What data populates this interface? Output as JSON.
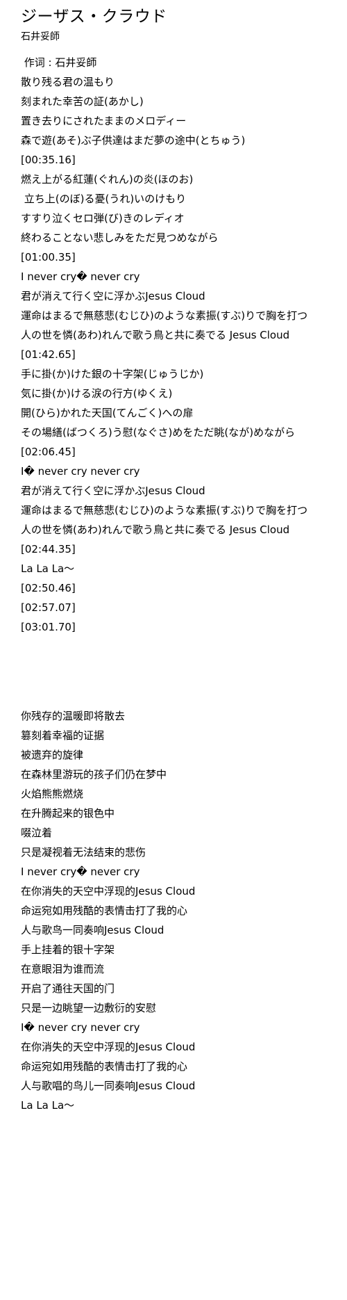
{
  "song": {
    "title": "ジーザス・クラウド",
    "artist": "石井妥師"
  },
  "primary_lyrics": {
    "lines": [
      {
        "text": " 作词 : 石井妥師",
        "type": "credit"
      },
      {
        "text": "散り残る君の温もり",
        "type": "lyric"
      },
      {
        "text": "刻まれた幸苦の証(あかし)",
        "type": "lyric"
      },
      {
        "text": "置き去りにされたままのメロディー",
        "type": "lyric"
      },
      {
        "text": "森で遊(あそ)ぶ子供達はまだ夢の途中(とちゅう)",
        "type": "lyric"
      },
      {
        "text": "[00:35.16]",
        "type": "timestamp"
      },
      {
        "text": "燃え上がる紅蓮(ぐれん)の炎(ほのお)",
        "type": "lyric"
      },
      {
        "text": " 立ち上(のぼ)る憂(うれ)いのけもり",
        "type": "lyric"
      },
      {
        "text": "すすり泣くセロ弾(び)きのレディオ",
        "type": "lyric"
      },
      {
        "text": "終わることない悲しみをただ見つめながら",
        "type": "lyric"
      },
      {
        "text": "[01:00.35]",
        "type": "timestamp"
      },
      {
        "text": "I never cry� never cry",
        "type": "latin"
      },
      {
        "text": "君が消えて行く空に浮かぶJesus Cloud",
        "type": "lyric"
      },
      {
        "text": "運命はまるで無慈悲(むじひ)のような素振(すぶ)りで胸を打つ",
        "type": "lyric"
      },
      {
        "text": "人の世を憐(あわ)れんで歌う鳥と共に奏でる Jesus Cloud",
        "type": "wrapped"
      },
      {
        "text": "[01:42.65]",
        "type": "timestamp"
      },
      {
        "text": "手に掛(か)けた銀の十字架(じゅうじか)",
        "type": "lyric"
      },
      {
        "text": "気に掛(か)ける涙の行方(ゆくえ)",
        "type": "lyric"
      },
      {
        "text": "開(ひら)かれた天国(てんごく)への扉",
        "type": "lyric"
      },
      {
        "text": "その場繕(ばつくろ)う慰(なぐさ)めをただ眺(なが)めながら",
        "type": "lyric"
      },
      {
        "text": "[02:06.45]",
        "type": "timestamp"
      },
      {
        "text": "I� never cry never cry",
        "type": "latin"
      },
      {
        "text": "君が消えて行く空に浮かぶJesus Cloud",
        "type": "lyric"
      },
      {
        "text": "運命はまるで無慈悲(むじひ)のような素振(すぶ)りで胸を打つ",
        "type": "lyric"
      },
      {
        "text": "人の世を憐(あわ)れんで歌う鳥と共に奏でる Jesus Cloud",
        "type": "wrapped"
      },
      {
        "text": "[02:44.35]",
        "type": "timestamp"
      },
      {
        "text": "La La La～",
        "type": "latin"
      },
      {
        "text": "[02:50.46]",
        "type": "timestamp"
      },
      {
        "text": "[02:57.07]",
        "type": "timestamp"
      },
      {
        "text": "[03:01.70]",
        "type": "timestamp"
      }
    ]
  },
  "translation_lyrics": {
    "lines": [
      {
        "text": "你残存的温暖即将散去",
        "type": "lyric"
      },
      {
        "text": "篡刻着幸福的证据",
        "type": "lyric"
      },
      {
        "text": "被遗弃的旋律",
        "type": "lyric"
      },
      {
        "text": "在森林里游玩的孩子们仍在梦中",
        "type": "lyric"
      },
      {
        "text": "火焰熊熊燃烧",
        "type": "lyric"
      },
      {
        "text": "在升腾起来的银色中",
        "type": "lyric"
      },
      {
        "text": "啜泣着",
        "type": "lyric"
      },
      {
        "text": "只是凝视着无法结束的悲伤",
        "type": "lyric"
      },
      {
        "text": "I never cry� never cry",
        "type": "latin"
      },
      {
        "text": "在你消失的天空中浮现的Jesus Cloud",
        "type": "lyric"
      },
      {
        "text": "命运宛如用残酷的表情击打了我的心",
        "type": "lyric"
      },
      {
        "text": "人与歌鸟一同奏响Jesus Cloud",
        "type": "lyric"
      },
      {
        "text": "手上挂着的银十字架",
        "type": "lyric"
      },
      {
        "text": "在意眼泪为谁而流",
        "type": "lyric"
      },
      {
        "text": "开启了通往天国的门",
        "type": "lyric"
      },
      {
        "text": "只是一边眺望一边敷衍的安慰",
        "type": "lyric"
      },
      {
        "text": "I� never cry never cry",
        "type": "latin"
      },
      {
        "text": "在你消失的天空中浮现的Jesus Cloud",
        "type": "lyric"
      },
      {
        "text": "命运宛如用残酷的表情击打了我的心",
        "type": "lyric"
      },
      {
        "text": "人与歌唱的鸟儿一同奏响Jesus Cloud",
        "type": "lyric"
      },
      {
        "text": "La La La～",
        "type": "latin"
      }
    ]
  },
  "colors": {
    "background": "#ffffff",
    "text": "#000000"
  }
}
